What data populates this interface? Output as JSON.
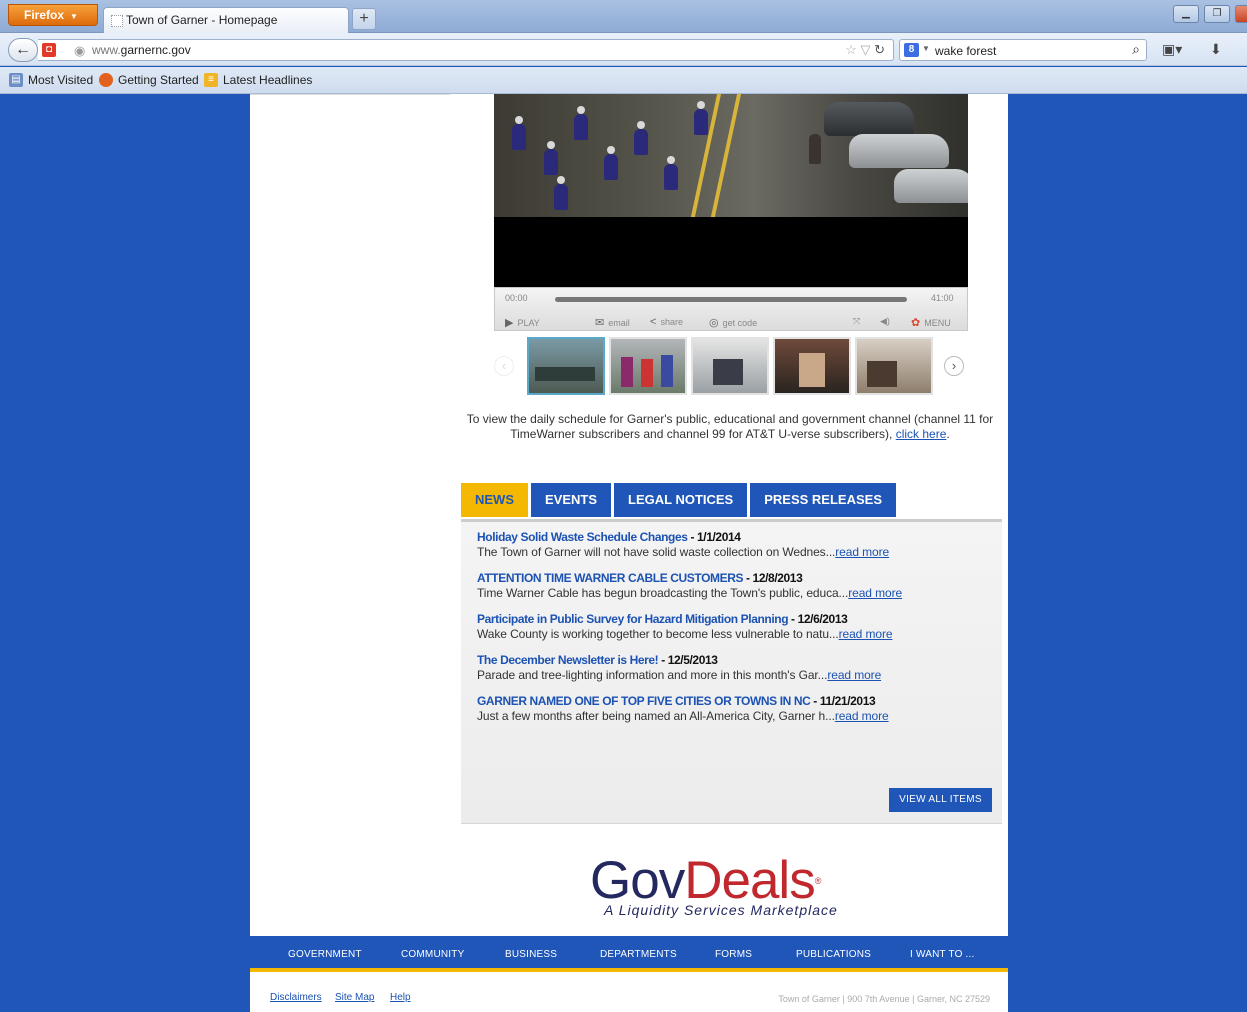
{
  "browser": {
    "menu_label": "Firefox",
    "tab_title": "Town of Garner - Homepage",
    "new_tab": "+",
    "url_prefix": "www.",
    "url_domain": "garnernc.gov",
    "search_engine": "8",
    "search_value": "wake forest",
    "bookmarks": [
      {
        "label": "Most Visited"
      },
      {
        "label": "Getting Started"
      },
      {
        "label": "Latest Headlines"
      }
    ]
  },
  "video": {
    "time_current": "00:00",
    "time_total": "41:00",
    "controls": {
      "play": "PLAY",
      "email": "email",
      "share": "share",
      "get_code": "get code",
      "menu": "MENU"
    }
  },
  "schedule": {
    "text": "To view the daily schedule for Garner's public, educational and government channel (channel 11 for TimeWarner subscribers and channel 99 for AT&T U-verse subscribers),",
    "link": "click here",
    "tail": "."
  },
  "tabs": [
    {
      "label": "NEWS",
      "active": true
    },
    {
      "label": "EVENTS",
      "active": false
    },
    {
      "label": "LEGAL NOTICES",
      "active": false
    },
    {
      "label": "PRESS RELEASES",
      "active": false
    }
  ],
  "news": [
    {
      "title": "Holiday Solid Waste Schedule Changes",
      "date": " - 1/1/2014",
      "desc": "The Town of Garner will not have solid waste collection on Wednes...",
      "more": "read more"
    },
    {
      "title": "ATTENTION TIME WARNER CABLE CUSTOMERS",
      "date": " - 12/8/2013",
      "desc": "Time Warner Cable has begun broadcasting the Town's public, educa...",
      "more": "read more"
    },
    {
      "title": "Participate in Public Survey for Hazard Mitigation Planning",
      "date": " - 12/6/2013",
      "desc": "Wake County is working together to become less vulnerable to natu...",
      "more": "read more"
    },
    {
      "title": "The December Newsletter is Here!",
      "date": " - 12/5/2013",
      "desc": "Parade and tree-lighting information and more in this month's Gar...",
      "more": "read more"
    },
    {
      "title": "GARNER NAMED ONE OF TOP FIVE CITIES OR TOWNS IN NC",
      "date": " - 11/21/2013",
      "desc": "Just a few months after being named an All-America City, Garner h...",
      "more": "read more"
    }
  ],
  "view_all": "VIEW ALL ITEMS",
  "ad": {
    "gov": "Gov",
    "deals": "Deals",
    "reg": "®",
    "tagline": "A Liquidity Services Marketplace"
  },
  "footer_nav": [
    "GOVERNMENT",
    "COMMUNITY",
    "BUSINESS",
    "DEPARTMENTS",
    "FORMS",
    "PUBLICATIONS",
    "I WANT TO ..."
  ],
  "footer_links": [
    "Disclaimers",
    "Site Map",
    "Help"
  ],
  "address": "Town of Garner | 900 7th Avenue | Garner, NC 27529",
  "colors": {
    "primary": "#1f56b8",
    "accent": "#f4b800",
    "link": "#1c52b2"
  }
}
